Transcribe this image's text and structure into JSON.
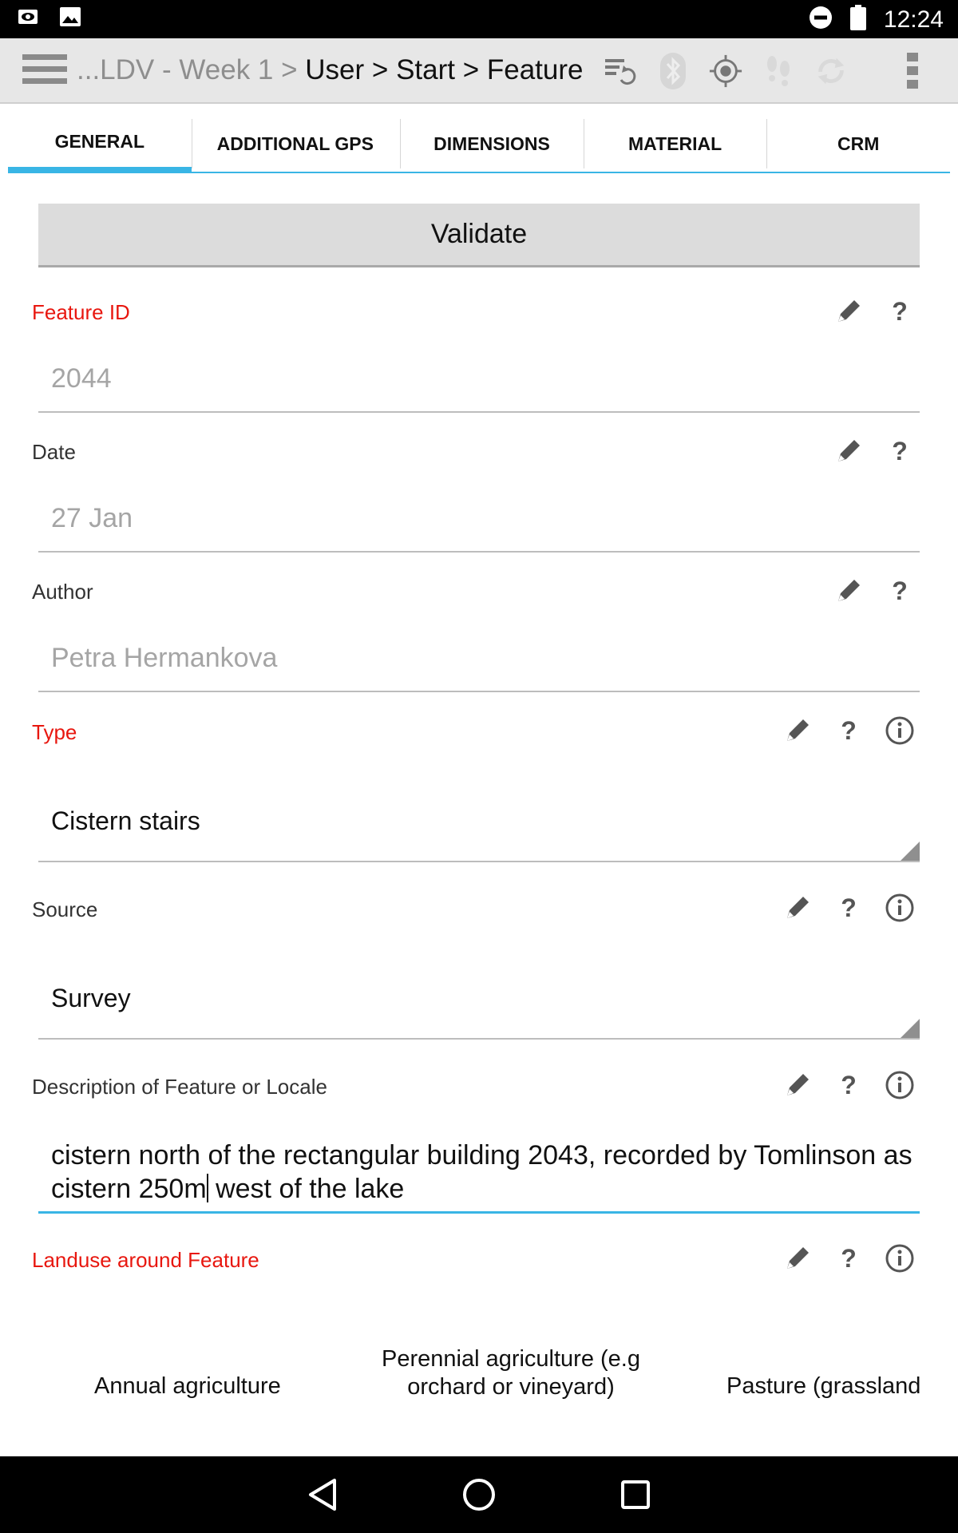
{
  "status_bar": {
    "time": "12:24",
    "left_icons": [
      "eye-notification-icon",
      "image-notification-icon"
    ],
    "right_icons": [
      "do-not-disturb-icon",
      "battery-icon"
    ]
  },
  "action_bar": {
    "breadcrumb_muted": "...LDV - Week 1 > ",
    "breadcrumb_main": "User > Start > Feature",
    "icons": [
      "sync-queue-icon",
      "bluetooth-icon",
      "gps-location-icon",
      "footsteps-icon",
      "refresh-icon",
      "overflow-menu-icon"
    ],
    "accent_color": "#39b5e5"
  },
  "tabs": [
    {
      "label": "GENERAL",
      "active": true
    },
    {
      "label": "ADDITIONAL GPS",
      "active": false
    },
    {
      "label": "DIMENSIONS",
      "active": false
    },
    {
      "label": "MATERIAL",
      "active": false
    },
    {
      "label": "CRM",
      "active": false
    }
  ],
  "validate_label": "Validate",
  "fields": {
    "feature_id": {
      "label": "Feature ID",
      "value": "2044",
      "required": true
    },
    "date": {
      "label": "Date",
      "value": "27 Jan",
      "required": false
    },
    "author": {
      "label": "Author",
      "value": "Petra Hermankova",
      "required": false
    },
    "type": {
      "label": "Type",
      "value": "Cistern stairs",
      "required": true
    },
    "source": {
      "label": "Source",
      "value": "Survey",
      "required": false
    },
    "description": {
      "label": "Description of Feature or Locale",
      "value_before_caret": "cistern north of the rectangular building 2043, recorded by Tomlinson as cistern 250m",
      "value_after_caret": " west of the lake",
      "required": false
    },
    "landuse": {
      "label": "Landuse around Feature",
      "required": true,
      "options": [
        "Annual agriculture",
        "Perennial agriculture (e.g orchard or vineyard)",
        "Pasture (grassland"
      ]
    }
  },
  "colors": {
    "required_label": "#e8170f",
    "accent": "#39b5e5"
  },
  "nav_bar": [
    "back-icon",
    "home-icon",
    "recents-icon"
  ]
}
